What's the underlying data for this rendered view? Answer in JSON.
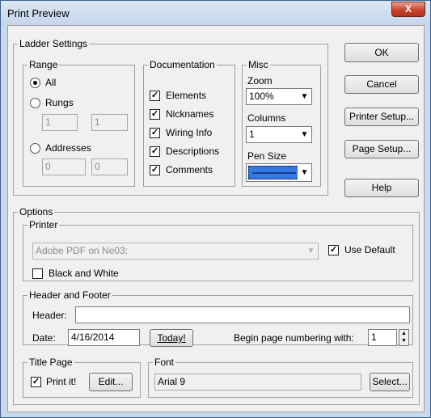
{
  "window": {
    "title": "Print Preview",
    "close_glyph": "X"
  },
  "ladder_settings": {
    "legend": "Ladder Settings",
    "range": {
      "legend": "Range",
      "all_label": "All",
      "rungs_label": "Rungs",
      "rungs_from": "1",
      "rungs_to": "1",
      "addresses_label": "Addresses",
      "addresses_from": "0",
      "addresses_to": "0",
      "selected": "All"
    },
    "documentation": {
      "legend": "Documentation",
      "items": [
        {
          "label": "Elements",
          "checked": true
        },
        {
          "label": "Nicknames",
          "checked": true
        },
        {
          "label": "Wiring Info",
          "checked": true
        },
        {
          "label": "Descriptions",
          "checked": true
        },
        {
          "label": "Comments",
          "checked": true
        }
      ]
    },
    "misc": {
      "legend": "Misc",
      "zoom_label": "Zoom",
      "zoom_value": "100%",
      "columns_label": "Columns",
      "columns_value": "1",
      "pen_size_label": "Pen Size"
    }
  },
  "buttons": {
    "ok": "OK",
    "cancel": "Cancel",
    "printer_setup": "Printer Setup...",
    "page_setup": "Page Setup...",
    "help": "Help"
  },
  "options": {
    "legend": "Options",
    "printer": {
      "legend": "Printer",
      "name": "Adobe PDF on Ne03:",
      "use_default_label": "Use Default",
      "use_default_checked": true,
      "bw_label": "Black and White",
      "bw_checked": false
    },
    "header_footer": {
      "legend": "Header and Footer",
      "header_label": "Header:",
      "header_value": "",
      "date_label": "Date:",
      "date_value": "4/16/2014",
      "today_button": "Today!",
      "page_num_label": "Begin page numbering with:",
      "page_num_value": "1"
    },
    "title_page": {
      "legend": "Title Page",
      "print_label": "Print it!",
      "print_checked": true,
      "edit_button": "Edit..."
    },
    "font": {
      "legend": "Font",
      "value": "Arial 9",
      "select_button": "Select..."
    }
  },
  "glyphs": {
    "check": "✓",
    "arrow_down": "▼",
    "arrow_up": "▲"
  },
  "colors": {
    "accent": "#3478e6",
    "close": "#c7432b"
  }
}
